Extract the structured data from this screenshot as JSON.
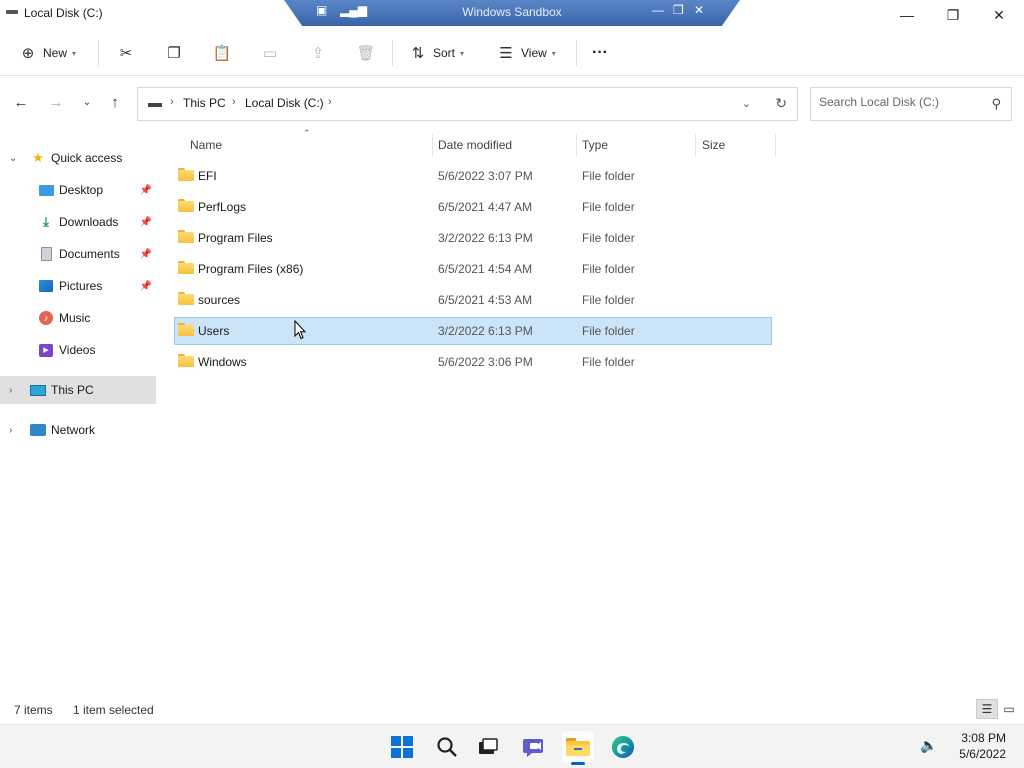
{
  "window": {
    "title": "Local Disk (C:)",
    "sandbox_title": "Windows Sandbox",
    "controls": {
      "minimize": "—",
      "maximize": "❐",
      "close": "✕"
    }
  },
  "command_bar": {
    "new_label": "New",
    "sort_label": "Sort",
    "view_label": "View",
    "more_label": "···"
  },
  "address": {
    "crumbs": [
      "This PC",
      "Local Disk (C:)"
    ],
    "search_placeholder": "Search Local Disk (C:)"
  },
  "sidebar": {
    "quick_access": "Quick access",
    "items": [
      {
        "label": "Desktop",
        "icon": "desktop-icon",
        "pinned": true
      },
      {
        "label": "Downloads",
        "icon": "downloads-icon",
        "pinned": true
      },
      {
        "label": "Documents",
        "icon": "documents-icon",
        "pinned": true
      },
      {
        "label": "Pictures",
        "icon": "pictures-icon",
        "pinned": true
      },
      {
        "label": "Music",
        "icon": "music-icon",
        "pinned": false
      },
      {
        "label": "Videos",
        "icon": "videos-icon",
        "pinned": false
      }
    ],
    "this_pc": "This PC",
    "network": "Network"
  },
  "columns": {
    "name": "Name",
    "date": "Date modified",
    "type": "Type",
    "size": "Size"
  },
  "files": [
    {
      "name": "EFI",
      "date": "5/6/2022 3:07 PM",
      "type": "File folder"
    },
    {
      "name": "PerfLogs",
      "date": "6/5/2021 4:47 AM",
      "type": "File folder"
    },
    {
      "name": "Program Files",
      "date": "3/2/2022 6:13 PM",
      "type": "File folder"
    },
    {
      "name": "Program Files (x86)",
      "date": "6/5/2021 4:54 AM",
      "type": "File folder"
    },
    {
      "name": "sources",
      "date": "6/5/2021 4:53 AM",
      "type": "File folder"
    },
    {
      "name": "Users",
      "date": "3/2/2022 6:13 PM",
      "type": "File folder",
      "selected": true
    },
    {
      "name": "Windows",
      "date": "5/6/2022 3:06 PM",
      "type": "File folder"
    }
  ],
  "status": {
    "count": "7 items",
    "selection": "1 item selected"
  },
  "taskbar": {
    "time": "3:08 PM",
    "date": "5/6/2022",
    "apps": [
      "start-icon",
      "search-icon",
      "task-view-icon",
      "teams-chat-icon",
      "file-explorer-icon",
      "edge-icon"
    ]
  },
  "colors": {
    "selection": "#cce4f7",
    "selection_border": "#99c9ef",
    "accent": "#0067c0",
    "folder": "#f5c140"
  }
}
